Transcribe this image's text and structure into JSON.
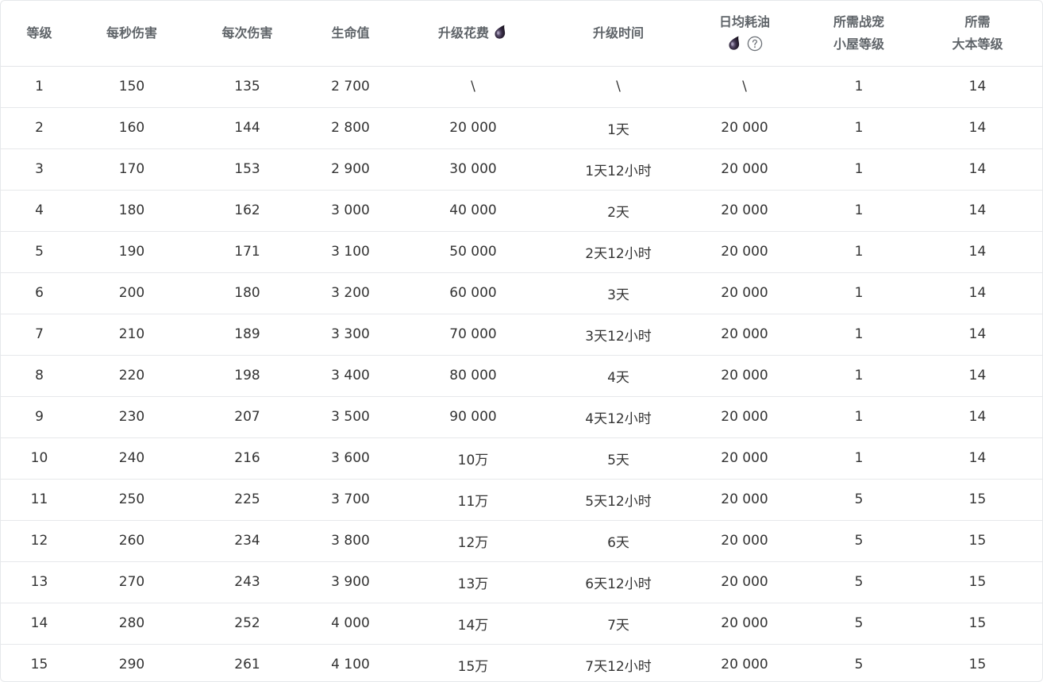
{
  "table": {
    "headers": {
      "level": "等级",
      "dps": "每秒伤害",
      "damage_per_hit": "每次伤害",
      "hp": "生命值",
      "upgrade_cost": "升级花费",
      "upgrade_time": "升级时间",
      "daily_oil": "日均耗油",
      "pet_house_line1": "所需战宠",
      "pet_house_line2": "小屋等级",
      "town_hall_line1": "所需",
      "town_hall_line2": "大本等级"
    },
    "icons": {
      "cost_icon": "dark-elixir-drop-icon",
      "daily_icon": "dark-elixir-drop-icon",
      "help_icon": "question-circle-icon"
    },
    "rows": [
      {
        "level": "1",
        "dps": "150",
        "dph": "135",
        "hp": "2 700",
        "cost": "\\",
        "time": "\\",
        "daily": "\\",
        "pet_house": "1",
        "th": "14"
      },
      {
        "level": "2",
        "dps": "160",
        "dph": "144",
        "hp": "2 800",
        "cost": "20 000",
        "time": "1天",
        "daily": "20 000",
        "pet_house": "1",
        "th": "14"
      },
      {
        "level": "3",
        "dps": "170",
        "dph": "153",
        "hp": "2 900",
        "cost": "30 000",
        "time": "1天12小时",
        "daily": "20 000",
        "pet_house": "1",
        "th": "14"
      },
      {
        "level": "4",
        "dps": "180",
        "dph": "162",
        "hp": "3 000",
        "cost": "40 000",
        "time": "2天",
        "daily": "20 000",
        "pet_house": "1",
        "th": "14"
      },
      {
        "level": "5",
        "dps": "190",
        "dph": "171",
        "hp": "3 100",
        "cost": "50 000",
        "time": "2天12小时",
        "daily": "20 000",
        "pet_house": "1",
        "th": "14"
      },
      {
        "level": "6",
        "dps": "200",
        "dph": "180",
        "hp": "3 200",
        "cost": "60 000",
        "time": "3天",
        "daily": "20 000",
        "pet_house": "1",
        "th": "14"
      },
      {
        "level": "7",
        "dps": "210",
        "dph": "189",
        "hp": "3 300",
        "cost": "70 000",
        "time": "3天12小时",
        "daily": "20 000",
        "pet_house": "1",
        "th": "14"
      },
      {
        "level": "8",
        "dps": "220",
        "dph": "198",
        "hp": "3 400",
        "cost": "80 000",
        "time": "4天",
        "daily": "20 000",
        "pet_house": "1",
        "th": "14"
      },
      {
        "level": "9",
        "dps": "230",
        "dph": "207",
        "hp": "3 500",
        "cost": "90 000",
        "time": "4天12小时",
        "daily": "20 000",
        "pet_house": "1",
        "th": "14"
      },
      {
        "level": "10",
        "dps": "240",
        "dph": "216",
        "hp": "3 600",
        "cost": "10万",
        "time": "5天",
        "daily": "20 000",
        "pet_house": "1",
        "th": "14"
      },
      {
        "level": "11",
        "dps": "250",
        "dph": "225",
        "hp": "3 700",
        "cost": "11万",
        "time": "5天12小时",
        "daily": "20 000",
        "pet_house": "5",
        "th": "15"
      },
      {
        "level": "12",
        "dps": "260",
        "dph": "234",
        "hp": "3 800",
        "cost": "12万",
        "time": "6天",
        "daily": "20 000",
        "pet_house": "5",
        "th": "15"
      },
      {
        "level": "13",
        "dps": "270",
        "dph": "243",
        "hp": "3 900",
        "cost": "13万",
        "time": "6天12小时",
        "daily": "20 000",
        "pet_house": "5",
        "th": "15"
      },
      {
        "level": "14",
        "dps": "280",
        "dph": "252",
        "hp": "4 000",
        "cost": "14万",
        "time": "7天",
        "daily": "20 000",
        "pet_house": "5",
        "th": "15"
      },
      {
        "level": "15",
        "dps": "290",
        "dph": "261",
        "hp": "4 100",
        "cost": "15万",
        "time": "7天12小时",
        "daily": "20 000",
        "pet_house": "5",
        "th": "15"
      }
    ]
  }
}
